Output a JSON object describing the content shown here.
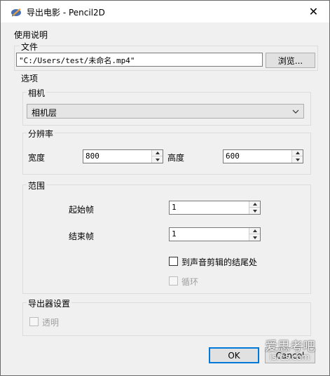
{
  "window": {
    "title": "导出电影 - Pencil2D"
  },
  "instructions_label": "使用说明",
  "file_group": {
    "title": "文件",
    "path": "\"C:/Users/test/未命名.mp4\"",
    "browse_label": "浏览..."
  },
  "options_label": "选项",
  "camera_group": {
    "title": "相机",
    "selected": "相机层"
  },
  "resolution_group": {
    "title": "分辨率",
    "width_label": "宽度",
    "width_value": "800",
    "height_label": "高度",
    "height_value": "600"
  },
  "range_group": {
    "title": "范围",
    "start_label": "起始帧",
    "start_value": "1",
    "end_label": "结束帧",
    "end_value": "1",
    "to_audio_end_label": "到声音剪辑的结尾处",
    "loop_label": "循环"
  },
  "exporter_group": {
    "title": "导出器设置",
    "transparency_label": "透明"
  },
  "buttons": {
    "ok": "OK",
    "cancel": "Cancel"
  },
  "watermark": {
    "main": "爱思考吧",
    "sub": "isres.com"
  },
  "colors": {
    "accent": "#0078d7",
    "background": "#f0f0f0",
    "titlebar": "#ffffff"
  }
}
